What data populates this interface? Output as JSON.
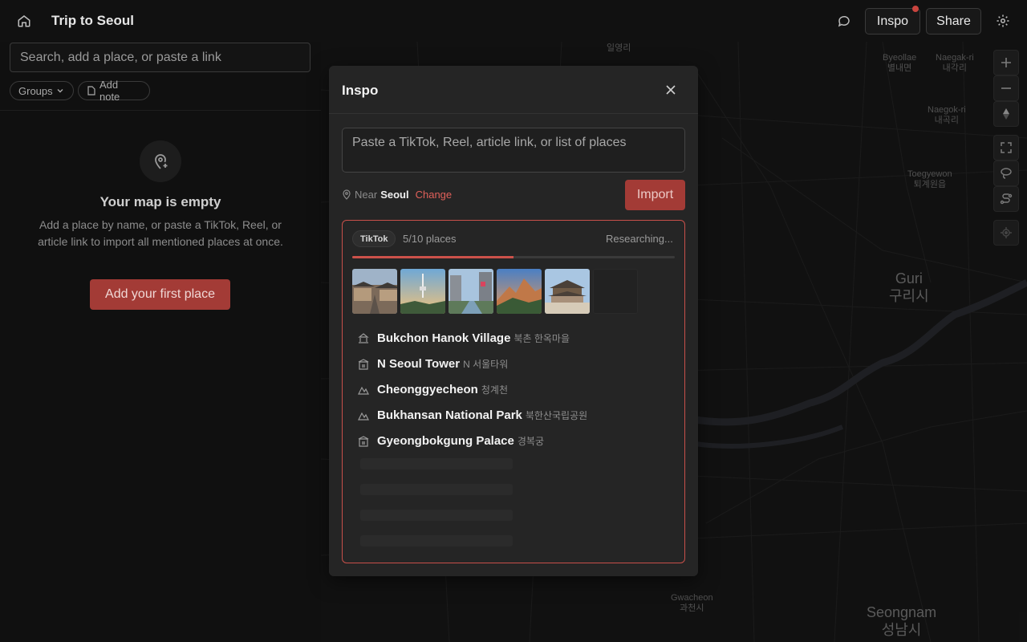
{
  "header": {
    "title": "Trip to Seoul",
    "inspo_label": "Inspo",
    "share_label": "Share"
  },
  "sidebar": {
    "search_placeholder": "Search, add a place, or paste a link",
    "groups_label": "Groups",
    "add_note_label": "Add note",
    "empty_title": "Your map is empty",
    "empty_desc": "Add a place by name, or paste a TikTok, Reel, or article link to import all mentioned places at once.",
    "add_first_label": "Add your first place"
  },
  "map": {
    "labels": [
      {
        "text": "일영리"
      },
      {
        "text": "Byeollae\n별내면"
      },
      {
        "text": "Naegak-ri\n내각리"
      },
      {
        "text": "Naegok-ri\n내곡리"
      },
      {
        "text": "Toegyewon\n퇴계원읍"
      },
      {
        "text": "Guri\n구리시"
      },
      {
        "text": "Gwacheon\n과천시"
      },
      {
        "text": "Seongnam\n성남시"
      }
    ]
  },
  "modal": {
    "title": "Inspo",
    "paste_placeholder": "Paste a TikTok, Reel, article link, or list of places",
    "near_prefix": "Near",
    "near_city": "Seoul",
    "change_label": "Change",
    "import_label": "Import",
    "result": {
      "source": "TikTok",
      "count": "5/10 places",
      "status": "Researching...",
      "progress": 0.5,
      "places": [
        {
          "name": "Bukchon Hanok Village",
          "native": "북촌 한옥마을",
          "icon": "landmark-icon"
        },
        {
          "name": "N Seoul Tower",
          "native": "N 서울타워",
          "icon": "building-icon"
        },
        {
          "name": "Cheonggyecheon",
          "native": "청계천",
          "icon": "mountain-icon"
        },
        {
          "name": "Bukhansan National Park",
          "native": "북한산국립공원",
          "icon": "mountain-icon"
        },
        {
          "name": "Gyeongbokgung Palace",
          "native": "경복궁",
          "icon": "building-icon"
        }
      ]
    }
  },
  "colors": {
    "accent": "#a33b36",
    "accent_border": "#c8504a"
  }
}
